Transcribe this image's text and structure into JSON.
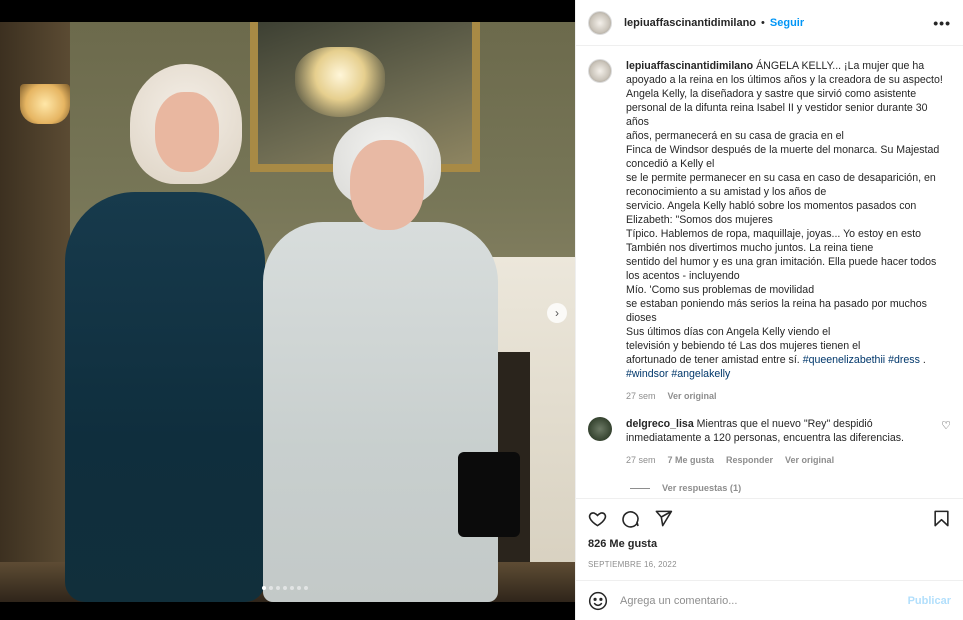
{
  "post": {
    "username": "lepiuaffascinantidimilano",
    "follow_label": "Seguir",
    "separator": "•",
    "more_icon": "more-horizontal-icon",
    "carousel": {
      "dots": 7,
      "active_index": 0,
      "next_icon": "chevron-right-icon"
    }
  },
  "caption": {
    "username": "lepiuaffascinantidimilano",
    "text": "ÁNGELA KELLY... ¡La mujer que ha apoyado a la reina en los últimos años y la creadora de su aspecto! Angela Kelly, la diseñadora y sastre que sirvió como asistente personal de la difunta reina Isabel II y vestidor senior durante 30 años\naños, permanecerá en su casa de gracia en el\nFinca de Windsor después de la muerte del monarca. Su Majestad concedió a Kelly el\nse le permite permanecer en su casa en caso de desaparición, en reconocimiento a su amistad y los años de\nservicio. Angela Kelly habló sobre los momentos pasados con Elizabeth: \"Somos dos mujeres\nTípico. Hablemos de ropa, maquillaje, joyas... Yo estoy en esto También nos divertimos mucho juntos. La reina tiene\nsentido del humor y es una gran imitación. Ella puede hacer todos los acentos - incluyendo\nMío. 'Como sus problemas de movilidad\nse estaban poniendo más serios la reina ha pasado por muchos dioses\nSus últimos días con Angela Kelly viendo el\ntelevisión y bebiendo té Las dos mujeres tienen el\nafortunado de tener amistad entre sí.",
    "hashtags": [
      "#queenelizabethii",
      "#dress",
      ".",
      "#windsor",
      "#angelakelly"
    ],
    "time": "27 sem",
    "translate_label": "Ver original"
  },
  "comment": {
    "username": "delgreco_lisa",
    "text": "Mientras que el nuevo \"Rey\" despidió inmediatamente a 120 personas, encuentra las diferencias.",
    "time": "27 sem",
    "likes_label": "7 Me gusta",
    "reply_label": "Responder",
    "translate_label": "Ver original",
    "replies_label": "Ver respuestas (1)"
  },
  "actions": {
    "like_icon": "heart-icon",
    "comment_icon": "comment-icon",
    "share_icon": "share-icon",
    "save_icon": "bookmark-icon"
  },
  "stats": {
    "likes_text": "826 Me gusta",
    "date_text": "SEPTIEMBRE 16, 2022"
  },
  "composer": {
    "emoji_icon": "emoji-icon",
    "placeholder": "Agrega un comentario...",
    "publish_label": "Publicar"
  },
  "colors": {
    "accent": "#0095f6",
    "publish_disabled": "#b2dffc",
    "hashtag": "#00376b",
    "muted": "#8e8e8e"
  }
}
